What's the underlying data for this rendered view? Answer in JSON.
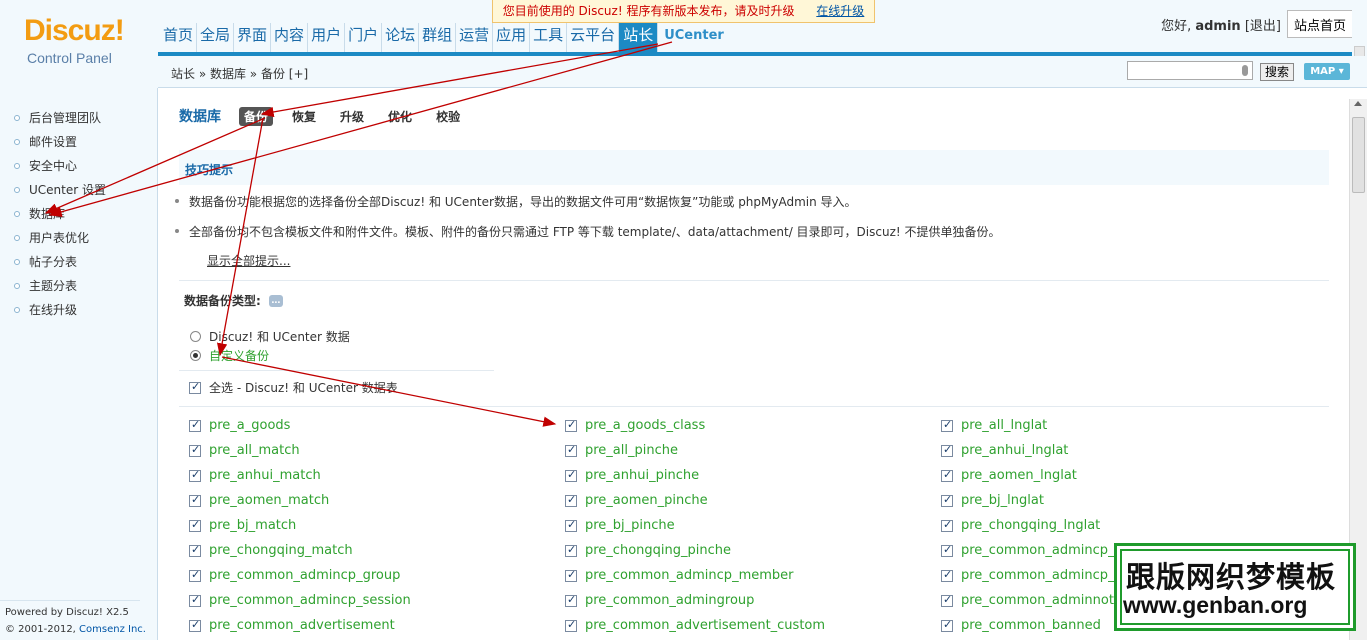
{
  "logo": {
    "title": "Discuz!",
    "subtitle": "Control Panel"
  },
  "notice": {
    "text": "您目前使用的 Discuz! 程序有新版本发布，请及时升级",
    "link": "在线升级"
  },
  "nav": [
    "首页",
    "全局",
    "界面",
    "内容",
    "用户",
    "门户",
    "论坛",
    "群组",
    "运营",
    "应用",
    "工具",
    "云平台",
    "站长",
    "UCenter"
  ],
  "nav_active": "站长",
  "user": {
    "greeting": "您好,",
    "name": "admin",
    "logout": "[退出]",
    "site_home": "站点首页"
  },
  "breadcrumb": "站长 » 数据库 » 备份 [+]",
  "search": {
    "button": "搜索",
    "map": "MAP ▾"
  },
  "sidebar": {
    "items": [
      "后台管理团队",
      "邮件设置",
      "安全中心",
      "UCenter 设置",
      "数据库",
      "用户表优化",
      "帖子分表",
      "主题分表",
      "在线升级"
    ],
    "powered": "Powered by Discuz! X2.5",
    "copy_prefix": "© 2001-2012, ",
    "copy_company": "Comsenz Inc."
  },
  "tabs": {
    "title": "数据库",
    "items": [
      "备份",
      "恢复",
      "升级",
      "优化",
      "校验"
    ]
  },
  "tips": {
    "title": "技巧提示",
    "items": [
      "数据备份功能根据您的选择备份全部Discuz! 和 UCenter数据，导出的数据文件可用“数据恢复”功能或 phpMyAdmin 导入。",
      "全部备份均不包含模板文件和附件文件。模板、附件的备份只需通过 FTP 等下载 template/、data/attachment/ 目录即可，Discuz! 不提供单独备份。"
    ],
    "show_all": "显示全部提示..."
  },
  "backup_type": {
    "label": "数据备份类型:",
    "options": [
      "Discuz! 和 UCenter 数据",
      "自定义备份"
    ],
    "selected": "自定义备份"
  },
  "select_all": "全选 - Discuz! 和 UCenter 数据表",
  "tables": [
    "pre_a_goods",
    "pre_a_goods_class",
    "pre_all_lnglat",
    "pre_all_match",
    "pre_all_pinche",
    "pre_anhui_lnglat",
    "pre_anhui_match",
    "pre_anhui_pinche",
    "pre_aomen_lnglat",
    "pre_aomen_match",
    "pre_aomen_pinche",
    "pre_bj_lnglat",
    "pre_bj_match",
    "pre_bj_pinche",
    "pre_chongqing_lnglat",
    "pre_chongqing_match",
    "pre_chongqing_pinche",
    "pre_common_admincp_",
    "pre_common_admincp_group",
    "pre_common_admincp_member",
    "pre_common_admincp_",
    "pre_common_admincp_session",
    "pre_common_admingroup",
    "pre_common_adminnot",
    "pre_common_advertisement",
    "pre_common_advertisement_custom",
    "pre_common_banned"
  ],
  "watermark": {
    "line1": "跟版网织梦模板",
    "line2": "www.genban.org"
  },
  "colors": {
    "accent": "#1c8ac4",
    "table_name": "#2fa12f",
    "arrow": "#c00000",
    "watermark": "#1f9b2c"
  }
}
